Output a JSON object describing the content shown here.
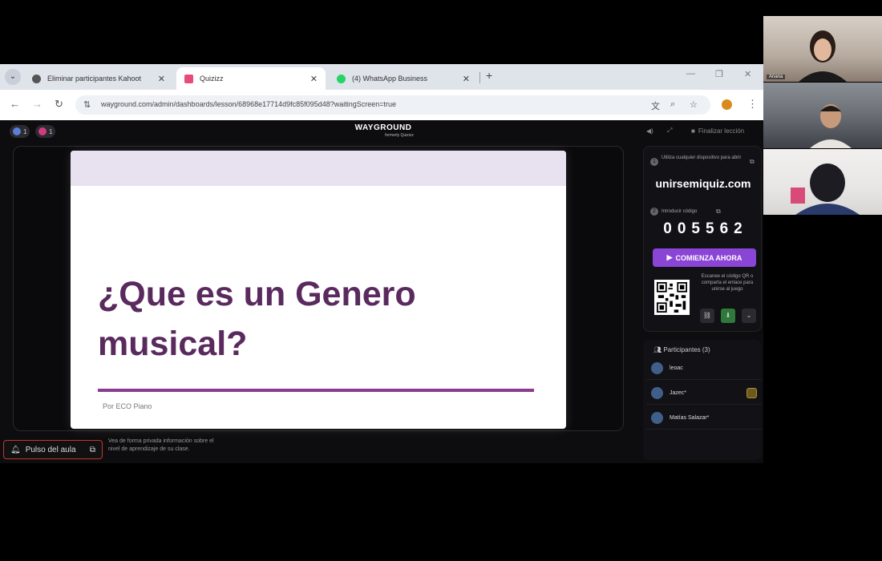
{
  "browser": {
    "tabs": [
      {
        "title": "Eliminar participantes Kahoot",
        "active": false,
        "favicon_color": "#555555"
      },
      {
        "title": "Quizizz",
        "active": true,
        "favicon_color": "#e84a7a"
      },
      {
        "title": "(4) WhatsApp Business",
        "active": false,
        "favicon_color": "#25d366"
      }
    ],
    "url": "wayground.com/admin/dashboards/lesson/68968e17714d9fc85f095d48?waitingScreen=true"
  },
  "app": {
    "logo_name": "WAYGROUND",
    "logo_sub": "formerly Quizizz",
    "counter_1": "1",
    "counter_2": "1",
    "finish_label": "Finalizar lección",
    "slide": {
      "title": "¿Que es un Genero musical?",
      "byline": "Por ECO Piano"
    },
    "pulse_label": "Pulso del aula",
    "pulse_desc": "Vea de forma privada información sobre el nivel de aprendizaje de su clase.",
    "join": {
      "hint": "Utiliza cualquier dispositivo para abrir",
      "url": "unirsemiquiz.com",
      "code_hint": "Introducir código",
      "code": "005562",
      "start_label": "COMIENZA AHORA",
      "qr_hint": "Escanee el código QR o comparta el enlace para unirse al juego"
    },
    "participants": {
      "heading": "Participantes (3)",
      "items": [
        {
          "name": "leoac"
        },
        {
          "name": "Jazec*"
        },
        {
          "name": "Matías Salazar*"
        }
      ]
    }
  },
  "video": {
    "tile1_name": "Ariana"
  },
  "colors": {
    "accent": "#8b45d6",
    "slide_title": "#5a2a5e",
    "slide_rule": "#8e3a92"
  }
}
